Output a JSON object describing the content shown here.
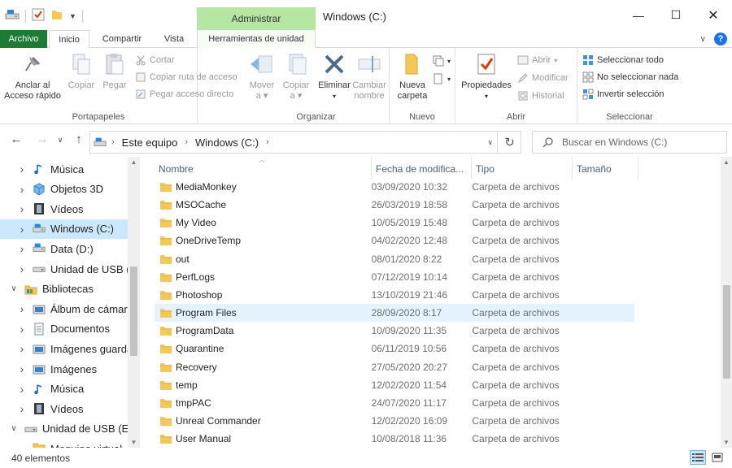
{
  "window": {
    "title": "Windows (C:)",
    "context_tab_header": "Administrar"
  },
  "tabs": [
    "Archivo",
    "Inicio",
    "Compartir",
    "Vista",
    "Herramientas de unidad"
  ],
  "ribbon": {
    "portapapeles": {
      "label": "Portapapeles",
      "anclar_line1": "Anclar al",
      "anclar_line2": "Acceso rápido",
      "copiar": "Copiar",
      "pegar": "Pegar",
      "cortar": "Cortar",
      "copiar_ruta": "Copiar ruta de acceso",
      "pegar_acceso": "Pegar acceso directo"
    },
    "organizar": {
      "label": "Organizar",
      "mover": "Mover",
      "copiar": "Copiar",
      "a": "a",
      "eliminar": "Eliminar",
      "cambiar_line1": "Cambiar",
      "cambiar_line2": "nombre"
    },
    "nuevo": {
      "label": "Nuevo",
      "nueva_line1": "Nueva",
      "nueva_line2": "carpeta"
    },
    "abrir": {
      "label": "Abrir",
      "propiedades": "Propiedades",
      "abrir": "Abrir",
      "modificar": "Modificar",
      "historial": "Historial"
    },
    "seleccionar": {
      "label": "Seleccionar",
      "todo": "Seleccionar todo",
      "nada": "No seleccionar nada",
      "invertir": "Invertir selección"
    }
  },
  "address": {
    "segments": [
      "Este equipo",
      "Windows (C:)"
    ],
    "search_placeholder": "Buscar en Windows (C:)"
  },
  "nav": [
    {
      "label": "Música",
      "icon": "music-icon",
      "indent": 1,
      "chevron": ">"
    },
    {
      "label": "Objetos 3D",
      "icon": "cube-icon",
      "indent": 1,
      "chevron": ">"
    },
    {
      "label": "Vídeos",
      "icon": "film-icon",
      "indent": 1,
      "chevron": ">"
    },
    {
      "label": "Windows (C:)",
      "icon": "drive-icon",
      "indent": 1,
      "chevron": ">",
      "selected": true
    },
    {
      "label": "Data (D:)",
      "icon": "drive-icon",
      "indent": 1,
      "chevron": ">"
    },
    {
      "label": "Unidad de USB (E",
      "icon": "usb-drive-icon",
      "indent": 1,
      "chevron": ">"
    },
    {
      "label": "Bibliotecas",
      "icon": "libraries-icon",
      "indent": 0,
      "chevron": "v"
    },
    {
      "label": "Álbum de cámara",
      "icon": "camera-roll-icon",
      "indent": 1,
      "chevron": ">"
    },
    {
      "label": "Documentos",
      "icon": "documents-icon",
      "indent": 1,
      "chevron": ">"
    },
    {
      "label": "Imágenes guarda",
      "icon": "saved-pictures-icon",
      "indent": 1,
      "chevron": ">"
    },
    {
      "label": "Imágenes",
      "icon": "pictures-icon",
      "indent": 1,
      "chevron": ">"
    },
    {
      "label": "Música",
      "icon": "music-icon",
      "indent": 1,
      "chevron": ">"
    },
    {
      "label": "Vídeos",
      "icon": "film-icon",
      "indent": 1,
      "chevron": ">"
    },
    {
      "label": "Unidad de USB (E:)",
      "icon": "usb-drive-icon",
      "indent": 0,
      "chevron": "v"
    },
    {
      "label": "Maquina virtual",
      "icon": "folder-icon",
      "indent": 1,
      "chevron": ""
    }
  ],
  "columns": [
    "Nombre",
    "Fecha de modifica...",
    "Tipo",
    "Tamaño"
  ],
  "files": [
    {
      "name": "MediaMonkey",
      "date": "03/09/2020 10:32",
      "type": "Carpeta de archivos"
    },
    {
      "name": "MSOCache",
      "date": "26/03/2019 18:58",
      "type": "Carpeta de archivos"
    },
    {
      "name": "My Video",
      "date": "10/05/2019 15:48",
      "type": "Carpeta de archivos"
    },
    {
      "name": "OneDriveTemp",
      "date": "04/02/2020 12:48",
      "type": "Carpeta de archivos"
    },
    {
      "name": "out",
      "date": "08/01/2020 8:22",
      "type": "Carpeta de archivos"
    },
    {
      "name": "PerfLogs",
      "date": "07/12/2019 10:14",
      "type": "Carpeta de archivos"
    },
    {
      "name": "Photoshop",
      "date": "13/10/2019 21:46",
      "type": "Carpeta de archivos"
    },
    {
      "name": "Program Files",
      "date": "28/09/2020 8:17",
      "type": "Carpeta de archivos",
      "selected": true
    },
    {
      "name": "ProgramData",
      "date": "10/09/2020 11:35",
      "type": "Carpeta de archivos"
    },
    {
      "name": "Quarantine",
      "date": "06/11/2019 10:56",
      "type": "Carpeta de archivos"
    },
    {
      "name": "Recovery",
      "date": "27/05/2020 20:27",
      "type": "Carpeta de archivos"
    },
    {
      "name": "temp",
      "date": "12/02/2020 11:54",
      "type": "Carpeta de archivos"
    },
    {
      "name": "tmpPAC",
      "date": "24/07/2020 11:17",
      "type": "Carpeta de archivos"
    },
    {
      "name": "Unreal Commander",
      "date": "12/02/2020 16:09",
      "type": "Carpeta de archivos"
    },
    {
      "name": "User Manual",
      "date": "10/08/2018 11:36",
      "type": "Carpeta de archivos"
    }
  ],
  "status": {
    "count": "40 elementos"
  },
  "colors": {
    "archivo_tab": "#1e7b35",
    "context_tab": "#b5e6a3",
    "selection": "#cce8ff",
    "folder": "#f4c857"
  }
}
